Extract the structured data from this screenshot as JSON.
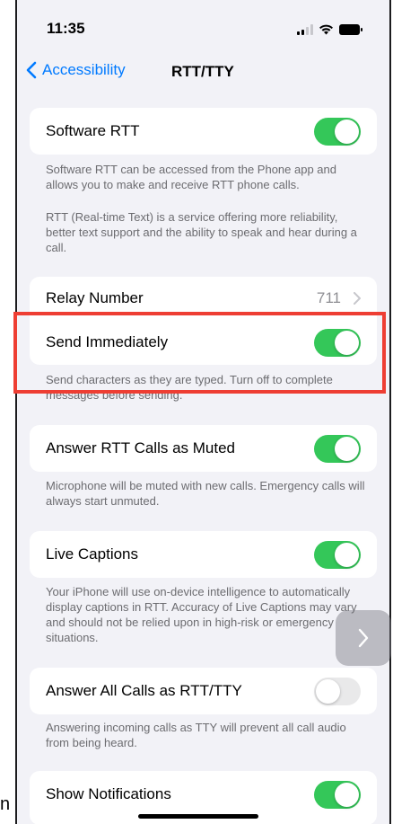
{
  "status_bar": {
    "time": "11:35",
    "icons": [
      "signal-icon",
      "wifi-icon",
      "battery-icon"
    ]
  },
  "nav": {
    "back_label": "Accessibility",
    "title": "RTT/TTY"
  },
  "settings": {
    "software_rtt": {
      "label": "Software RTT",
      "enabled": true,
      "footer_1": "Software RTT can be accessed from the Phone app and allows you to make and receive RTT phone calls.",
      "footer_2": "RTT (Real-time Text) is a service offering more reliability, better text support and the ability to speak and hear during a call."
    },
    "relay_number": {
      "label": "Relay Number",
      "value": "711"
    },
    "send_immediately": {
      "label": "Send Immediately",
      "enabled": true,
      "footer": "Send characters as they are typed. Turn off to complete messages before sending."
    },
    "answer_muted": {
      "label": "Answer RTT Calls as Muted",
      "enabled": true,
      "footer": "Microphone will be muted with new calls. Emergency calls will always start unmuted."
    },
    "live_captions": {
      "label": "Live Captions",
      "enabled": true,
      "footer": "Your iPhone will use on-device intelligence to automatically display captions in RTT. Accuracy of Live Captions may vary and should not be relied upon in high-risk or emergency situations."
    },
    "answer_all": {
      "label": "Answer All Calls as RTT/TTY",
      "enabled": false,
      "footer": "Answering incoming calls as TTY will prevent all call audio from being heard."
    },
    "show_notifications": {
      "label": "Show Notifications",
      "enabled": true
    }
  },
  "edge_text": "n",
  "colors": {
    "accent": "#007aff",
    "toggle_on": "#34c759",
    "toggle_off": "#e9e9ea",
    "highlight": "#ee3e33",
    "background": "#f2f2f7"
  }
}
